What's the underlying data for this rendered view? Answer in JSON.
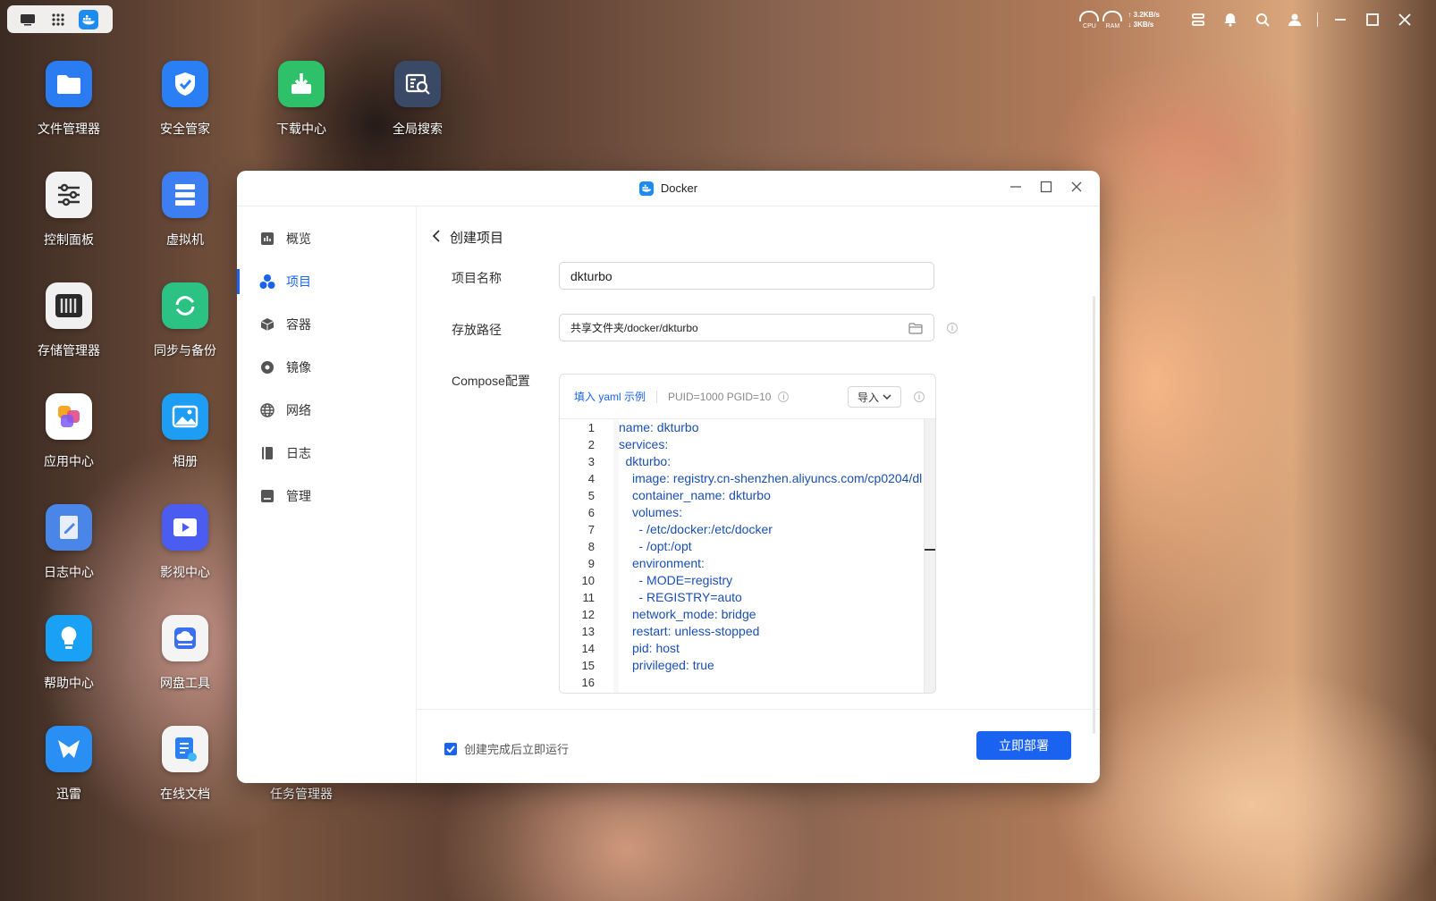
{
  "topbar": {
    "cpu_label": "CPU",
    "ram_label": "RAM",
    "upload_speed": "↑ 3.2KB/s",
    "download_speed": "↓ 3KB/s"
  },
  "desktop": {
    "apps": [
      {
        "label": "文件管理器",
        "color": "#2b7cf0"
      },
      {
        "label": "安全管家",
        "color": "#2a7ff5"
      },
      {
        "label": "下载中心",
        "color": "#2fc16a"
      },
      {
        "label": "全局搜索",
        "color": "#3a4a66"
      },
      {
        "label": "控制面板",
        "color": "#f2f2f2"
      },
      {
        "label": "虚拟机",
        "color": "#3d7ef2"
      },
      {
        "label": "存储管理器",
        "color": "#f0f0f0"
      },
      {
        "label": "同步与备份",
        "color": "#2cc283"
      },
      {
        "label": "应用中心",
        "color": "#ffffff"
      },
      {
        "label": "相册",
        "color": "#1e9df5"
      },
      {
        "label": "日志中心",
        "color": "#4a86e8"
      },
      {
        "label": "影视中心",
        "color": "#4b5cf0"
      },
      {
        "label": "帮助中心",
        "color": "#19a2f5"
      },
      {
        "label": "网盘工具",
        "color": "#f4f4f4"
      },
      {
        "label": "迅雷",
        "color": "#2a8ff5"
      },
      {
        "label": "在线文档",
        "color": "#f4f4f4"
      },
      {
        "label": "任务管理器",
        "color": "#6a5a60"
      }
    ]
  },
  "window": {
    "title": "Docker",
    "nav": [
      "概览",
      "项目",
      "容器",
      "镜像",
      "网络",
      "日志",
      "管理"
    ],
    "back_label": "创建项目",
    "form": {
      "name_label": "项目名称",
      "name_value": "dkturbo",
      "path_label": "存放路径",
      "path_value": "共享文件夹/docker/dkturbo",
      "compose_label": "Compose配置",
      "fill_yaml": "填入 yaml 示例",
      "env_hint": "PUID=1000 PGID=10",
      "import_label": "导入",
      "code_lines": [
        {
          "no": "1",
          "indent": 0,
          "key": "name:",
          "val": " dkturbo"
        },
        {
          "no": "2",
          "indent": 0,
          "key": "services:",
          "val": ""
        },
        {
          "no": "3",
          "indent": 1,
          "key": "dkturbo:",
          "val": ""
        },
        {
          "no": "4",
          "indent": 2,
          "key": "image:",
          "val": " registry.cn-shenzhen.aliyuncs.com/cp0204/dl"
        },
        {
          "no": "5",
          "indent": 2,
          "key": "container_name:",
          "val": " dkturbo"
        },
        {
          "no": "6",
          "indent": 2,
          "key": "volumes:",
          "val": ""
        },
        {
          "no": "7",
          "indent": 3,
          "key": "- /etc/docker:/etc/docker",
          "val": ""
        },
        {
          "no": "8",
          "indent": 3,
          "key": "- /opt:/opt",
          "val": ""
        },
        {
          "no": "9",
          "indent": 2,
          "key": "environment:",
          "val": ""
        },
        {
          "no": "10",
          "indent": 3,
          "key": "- MODE=registry",
          "val": ""
        },
        {
          "no": "11",
          "indent": 3,
          "key": "- REGISTRY=auto",
          "val": ""
        },
        {
          "no": "12",
          "indent": 2,
          "key": "network_mode:",
          "val": " bridge"
        },
        {
          "no": "13",
          "indent": 2,
          "key": "restart:",
          "val": " unless-stopped"
        },
        {
          "no": "14",
          "indent": 2,
          "key": "pid:",
          "val": " host"
        },
        {
          "no": "15",
          "indent": 2,
          "key": "privileged:",
          "val": " true"
        },
        {
          "no": "16",
          "indent": 0,
          "key": "",
          "val": ""
        }
      ]
    },
    "run_after_create": "创建完成后立即运行",
    "deploy_label": "立即部署"
  }
}
